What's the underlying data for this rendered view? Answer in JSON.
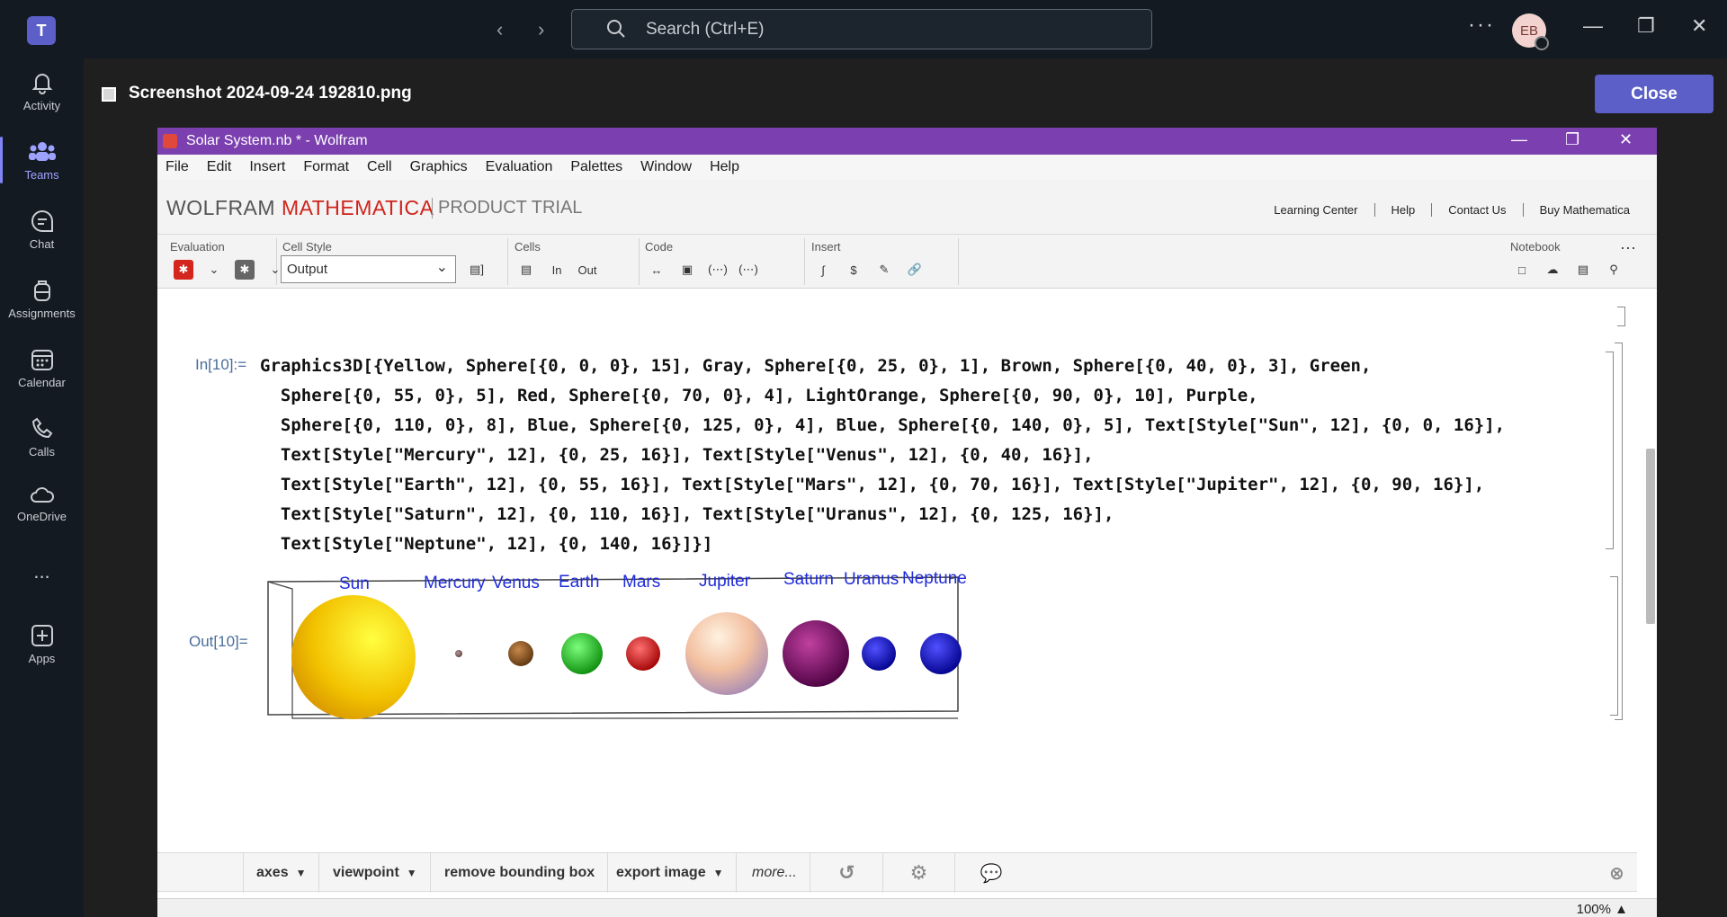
{
  "teams": {
    "search_placeholder": "Search (Ctrl+E)",
    "avatar_initials": "EB",
    "rail": [
      {
        "label": "Activity",
        "icon": "bell-icon"
      },
      {
        "label": "Teams",
        "icon": "teams-icon"
      },
      {
        "label": "Chat",
        "icon": "chat-icon"
      },
      {
        "label": "Assignments",
        "icon": "backpack-icon"
      },
      {
        "label": "Calendar",
        "icon": "calendar-icon"
      },
      {
        "label": "Calls",
        "icon": "phone-icon"
      },
      {
        "label": "OneDrive",
        "icon": "cloud-icon"
      },
      {
        "label": "...",
        "icon": "more-icon"
      },
      {
        "label": "Apps",
        "icon": "apps-icon"
      }
    ],
    "file_name": "Screenshot 2024-09-24 192810.png",
    "close_label": "Close"
  },
  "wolfram": {
    "window_title": "Solar System.nb * - Wolfram",
    "menu": [
      "File",
      "Edit",
      "Insert",
      "Format",
      "Cell",
      "Graphics",
      "Evaluation",
      "Palettes",
      "Window",
      "Help"
    ],
    "brand_wolfram": "WOLFRAM ",
    "brand_mathematica": "MATHEMATICA",
    "brand_trial": "PRODUCT TRIAL",
    "links": [
      "Learning Center",
      "Help",
      "Contact Us",
      "Buy Mathematica"
    ],
    "toolbar_groups": [
      "Evaluation",
      "Cell Style",
      "Cells",
      "Code",
      "Insert",
      "Notebook"
    ],
    "cell_style_value": "Output",
    "in_label": "In[10]:=",
    "out_label": "Out[10]=",
    "code_lines": [
      "Graphics3D[{Yellow, Sphere[{0, 0, 0}, 15], Gray, Sphere[{0, 25, 0}, 1], Brown, Sphere[{0, 40, 0}, 3], Green,",
      "  Sphere[{0, 55, 0}, 5], Red, Sphere[{0, 70, 0}, 4], LightOrange, Sphere[{0, 90, 0}, 10], Purple,",
      "  Sphere[{0, 110, 0}, 8], Blue, Sphere[{0, 125, 0}, 4], Blue, Sphere[{0, 140, 0}, 5], Text[Style[\"Sun\", 12], {0, 0, 16}],",
      "  Text[Style[\"Mercury\", 12], {0, 25, 16}], Text[Style[\"Venus\", 12], {0, 40, 16}],",
      "  Text[Style[\"Earth\", 12], {0, 55, 16}], Text[Style[\"Mars\", 12], {0, 70, 16}], Text[Style[\"Jupiter\", 12], {0, 90, 16}],",
      "  Text[Style[\"Saturn\", 12], {0, 110, 16}], Text[Style[\"Uranus\", 12], {0, 125, 16}],",
      "  Text[Style[\"Neptune\", 12], {0, 140, 16}]}]"
    ],
    "planets": [
      {
        "name": "Sun",
        "color": "#f5d800"
      },
      {
        "name": "Mercury",
        "color": "#8a6a6a"
      },
      {
        "name": "Venus",
        "color": "#8b5a2b"
      },
      {
        "name": "Earth",
        "color": "#2ecc2e"
      },
      {
        "name": "Mars",
        "color": "#e51b1b"
      },
      {
        "name": "Jupiter",
        "color": "#f7d6c4"
      },
      {
        "name": "Saturn",
        "color": "#8b0a6e"
      },
      {
        "name": "Uranus",
        "color": "#1212d8"
      },
      {
        "name": "Neptune",
        "color": "#1212d8"
      }
    ],
    "context_bar": [
      "axes",
      "viewpoint",
      "remove bounding box",
      "export image",
      "more..."
    ],
    "zoom": "100%"
  }
}
